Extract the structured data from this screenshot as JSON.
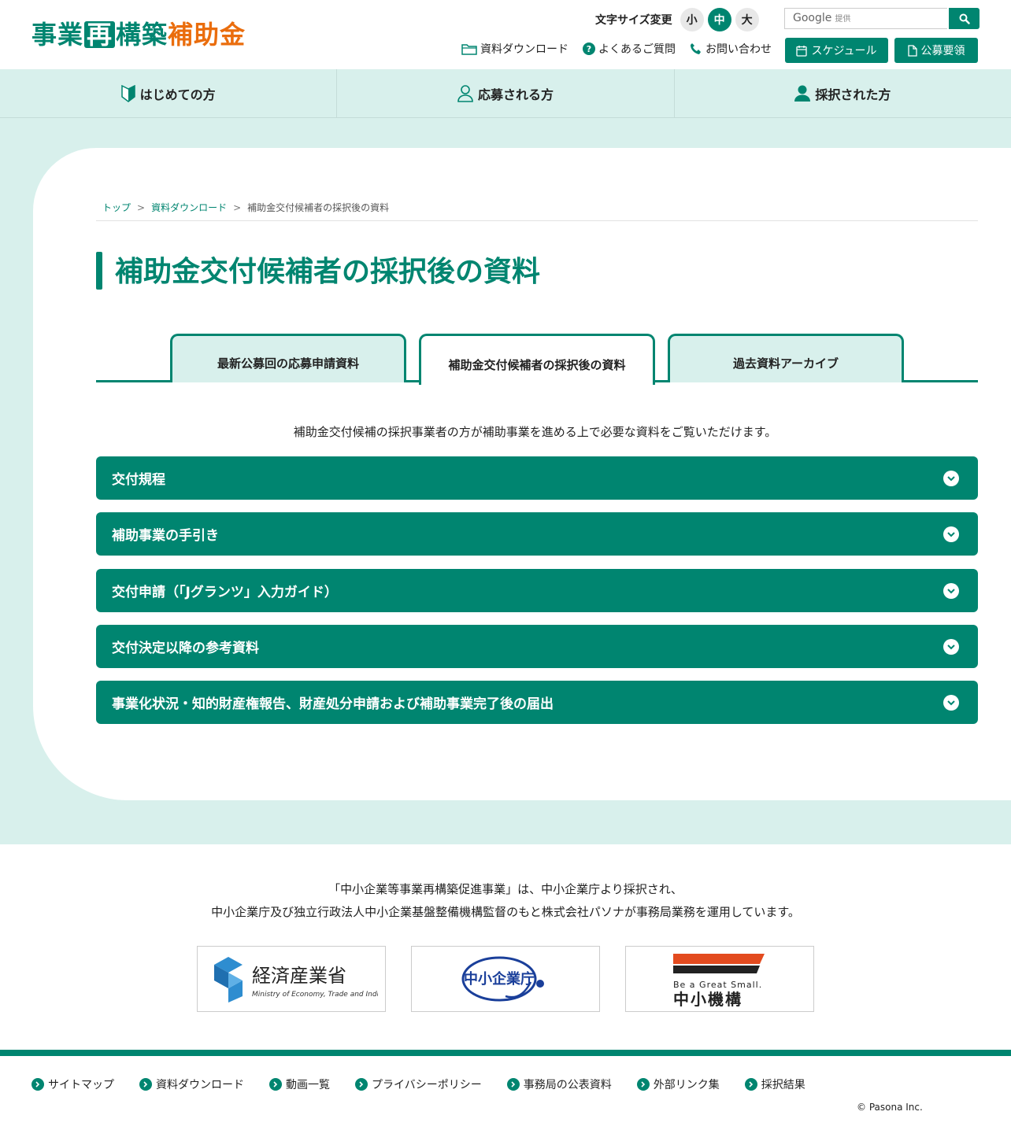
{
  "header": {
    "logo": {
      "part1": "事業",
      "part2": "再",
      "part3": "構築",
      "part4": "補助金"
    },
    "font_size": {
      "label": "文字サイズ変更",
      "small": "小",
      "medium": "中",
      "large": "大",
      "selected": "中"
    },
    "search": {
      "placeholder_brand": "Google",
      "placeholder_suffix": "提供"
    },
    "util_links": [
      "資料ダウンロード",
      "よくあるご質問",
      "お問い合わせ"
    ],
    "buttons": {
      "schedule": "スケジュール",
      "koubo": "公募要領"
    }
  },
  "nav": {
    "items": [
      "はじめての方",
      "応募される方",
      "採択された方"
    ]
  },
  "breadcrumb": {
    "items": [
      "トップ",
      "資料ダウンロード",
      "補助金交付候補者の採択後の資料"
    ],
    "separator": ">"
  },
  "page": {
    "title": "補助金交付候補者の採択後の資料",
    "tabs": [
      "最新公募回の応募申請資料",
      "補助金交付候補者の採択後の資料",
      "過去資料アーカイブ"
    ],
    "active_tab": "補助金交付候補者の採択後の資料",
    "lead": "補助金交付候補の採択事業者の方が補助事業を進める上で必要な資料をご覧いただけます。",
    "accordion": [
      "交付規程",
      "補助事業の手引き",
      "交付申請（「Jグランツ」入力ガイド）",
      "交付決定以降の参考資料",
      "事業化状況・知的財産権報告、財産処分申請および補助事業完了後の届出"
    ]
  },
  "footer": {
    "note_line1": "「中小企業等事業再構築促進事業」は、中小企業庁より採択され、",
    "note_line2": "中小企業庁及び独立行政法人中小企業基盤整備機構監督のもと株式会社パソナが事務局業務を運用しています。",
    "logos": {
      "meti_jp": "経済産業省",
      "meti_en": "Ministry of Economy, Trade and Industry",
      "chusho": "中小企業庁",
      "smrj_tag": "Be a Great Small.",
      "smrj_jp": "中小機構"
    },
    "links": [
      "サイトマップ",
      "資料ダウンロード",
      "動画一覧",
      "プライバシーポリシー",
      "事務局の公表資料",
      "外部リンク集",
      "採択結果"
    ],
    "copyright": "© Pasona Inc."
  },
  "colors": {
    "brand_green": "#008570",
    "brand_orange": "#ea6d0d",
    "band_bg": "#d8f0ec"
  }
}
